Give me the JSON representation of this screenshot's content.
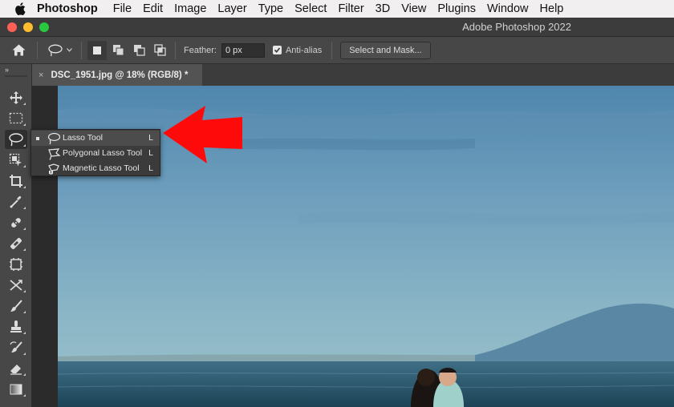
{
  "menubar": {
    "apple_icon": "apple-icon",
    "items": [
      "Photoshop",
      "File",
      "Edit",
      "Image",
      "Layer",
      "Type",
      "Select",
      "Filter",
      "3D",
      "View",
      "Plugins",
      "Window",
      "Help"
    ]
  },
  "window": {
    "title": "Adobe Photoshop 2022"
  },
  "options": {
    "feather_label": "Feather:",
    "feather_value": "0 px",
    "antialias_label": "Anti-alias",
    "antialias_checked": true,
    "select_mask_label": "Select and Mask..."
  },
  "tab": {
    "close": "×",
    "name": "DSC_1951.jpg @ 18% (RGB/8) *"
  },
  "toolbar": {
    "collapse": "››",
    "tools": [
      "move-tool-icon",
      "marquee-tool-icon",
      "lasso-tool-icon",
      "object-select-tool-icon",
      "crop-tool-icon",
      "eyedropper-tool-icon",
      "healing-brush-tool-icon",
      "patch-tool-icon",
      "frame-tool-icon",
      "content-aware-move-icon",
      "brush-tool-icon",
      "clone-stamp-tool-icon",
      "history-brush-tool-icon",
      "eraser-tool-icon",
      "gradient-tool-icon"
    ]
  },
  "flyout": {
    "items": [
      {
        "label": "Lasso Tool",
        "key": "L",
        "selected": true,
        "icon": "lasso-icon"
      },
      {
        "label": "Polygonal Lasso Tool",
        "key": "L",
        "selected": false,
        "icon": "polygonal-lasso-icon"
      },
      {
        "label": "Magnetic Lasso Tool",
        "key": "L",
        "selected": false,
        "icon": "magnetic-lasso-icon"
      }
    ]
  },
  "colors": {
    "annotation_arrow": "#ff0000",
    "panel": "#474747",
    "menubar": "#f1eff0"
  }
}
